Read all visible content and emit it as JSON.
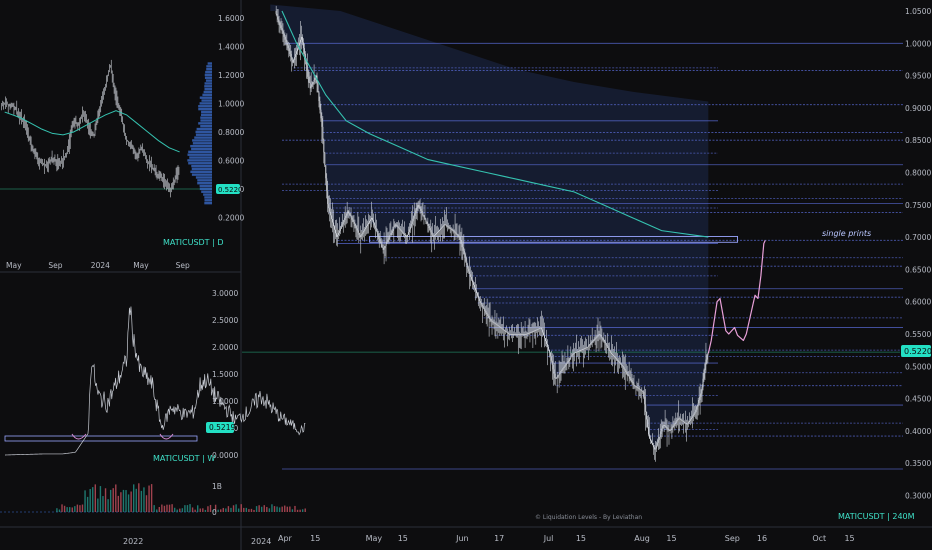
{
  "colors": {
    "background": "#0d0d0f",
    "candle": "#cfd3da",
    "moving_average": "#35c2b0",
    "zone_fill": "#1d2a4d",
    "level_line": "#5a6bd8",
    "projection": "#e8a0d8",
    "price_tag": "#23e0c4",
    "divider": "#2a2e39"
  },
  "chart_data": [
    {
      "id": "main",
      "type": "candlestick",
      "symbol_label": "MATICUSDT",
      "timeframe": "240M",
      "watermark": "© Liquidation Levels - By Leviathan",
      "annotation": "single prints",
      "current_price_label": "0.5220",
      "y_ticks": [
        "1.0500",
        "1.0000",
        "0.9500",
        "0.9000",
        "0.8500",
        "0.8000",
        "0.7500",
        "0.7000",
        "0.6500",
        "0.6000",
        "0.5500",
        "0.5000",
        "0.4500",
        "0.4000",
        "0.3500",
        "0.3000"
      ],
      "ylim": [
        0.28,
        1.06
      ],
      "x_ticks": [
        "Apr",
        "15",
        "May",
        "15",
        "Jun",
        "17",
        "Jul",
        "15",
        "Aug",
        "15",
        "Sep",
        "16",
        "Oct",
        "15"
      ],
      "x_tick_values": [
        0,
        11,
        30,
        41,
        61,
        74,
        91,
        102,
        122,
        133,
        153,
        164,
        183,
        194
      ],
      "price_path": [
        [
          -2,
          1.05
        ],
        [
          4,
          0.97
        ],
        [
          7,
          1.01
        ],
        [
          10,
          0.93
        ],
        [
          12,
          0.95
        ],
        [
          14,
          0.87
        ],
        [
          16,
          0.75
        ],
        [
          19,
          0.7
        ],
        [
          23,
          0.74
        ],
        [
          27,
          0.7
        ],
        [
          31,
          0.73
        ],
        [
          35,
          0.68
        ],
        [
          39,
          0.72
        ],
        [
          43,
          0.7
        ],
        [
          47,
          0.75
        ],
        [
          52,
          0.7
        ],
        [
          56,
          0.72
        ],
        [
          59,
          0.71
        ],
        [
          61,
          0.7
        ],
        [
          64,
          0.65
        ],
        [
          68,
          0.6
        ],
        [
          72,
          0.57
        ],
        [
          78,
          0.55
        ],
        [
          84,
          0.55
        ],
        [
          89,
          0.56
        ],
        [
          92,
          0.52
        ],
        [
          94,
          0.48
        ],
        [
          97,
          0.5
        ],
        [
          100,
          0.52
        ],
        [
          105,
          0.53
        ],
        [
          109,
          0.55
        ],
        [
          113,
          0.52
        ],
        [
          117,
          0.5
        ],
        [
          121,
          0.47
        ],
        [
          124,
          0.46
        ],
        [
          126,
          0.39
        ],
        [
          128,
          0.37
        ],
        [
          131,
          0.41
        ],
        [
          133,
          0.4
        ],
        [
          136,
          0.42
        ],
        [
          139,
          0.41
        ],
        [
          142,
          0.43
        ],
        [
          144,
          0.46
        ],
        [
          145,
          0.5
        ],
        [
          146,
          0.52
        ]
      ],
      "moving_average_path": [
        [
          0,
          1.05
        ],
        [
          5,
          1.0
        ],
        [
          10,
          0.96
        ],
        [
          15,
          0.92
        ],
        [
          22,
          0.88
        ],
        [
          30,
          0.86
        ],
        [
          40,
          0.84
        ],
        [
          50,
          0.82
        ],
        [
          60,
          0.81
        ],
        [
          70,
          0.8
        ],
        [
          80,
          0.79
        ],
        [
          90,
          0.78
        ],
        [
          100,
          0.77
        ],
        [
          110,
          0.75
        ],
        [
          120,
          0.73
        ],
        [
          130,
          0.71
        ],
        [
          146,
          0.7
        ]
      ],
      "projection_path": [
        [
          146,
          0.52
        ],
        [
          147,
          0.54
        ],
        [
          148,
          0.57
        ],
        [
          149,
          0.6
        ],
        [
          150,
          0.605
        ],
        [
          151,
          0.58
        ],
        [
          152,
          0.555
        ],
        [
          153,
          0.55
        ],
        [
          154,
          0.555
        ],
        [
          155,
          0.56
        ],
        [
          156,
          0.548
        ],
        [
          158,
          0.54
        ],
        [
          159,
          0.55
        ],
        [
          160,
          0.57
        ],
        [
          161,
          0.59
        ],
        [
          162,
          0.61
        ],
        [
          163,
          0.605
        ],
        [
          164,
          0.64
        ],
        [
          165,
          0.69
        ],
        [
          165.5,
          0.695
        ]
      ],
      "levels": [
        1.0,
        0.962,
        0.958,
        0.905,
        0.88,
        0.862,
        0.85,
        0.83,
        0.812,
        0.782,
        0.772,
        0.76,
        0.752,
        0.745,
        0.738,
        0.695,
        0.69,
        0.668,
        0.655,
        0.64,
        0.62,
        0.607,
        0.598,
        0.575,
        0.56,
        0.548,
        0.525,
        0.515,
        0.505,
        0.49,
        0.47,
        0.455,
        0.44,
        0.412,
        0.402,
        0.392,
        0.341
      ],
      "single_prints_box": {
        "x": [
          30,
          156
        ],
        "y": [
          0.692,
          0.701
        ]
      }
    },
    {
      "id": "daily",
      "type": "candlestick",
      "symbol_label": "MATICUSDT",
      "timeframe": "D",
      "current_price_label": "0.5220",
      "y_ticks": [
        "1.6000",
        "1.4000",
        "1.2000",
        "1.0000",
        "0.8000",
        "0.6000",
        "0.4000",
        "0.2000"
      ],
      "ylim": [
        0.15,
        1.72
      ],
      "x_ticks": [
        "May",
        "Sep",
        "2024",
        "May",
        "Sep"
      ],
      "x_tick_values": [
        0,
        4,
        8,
        12,
        16
      ],
      "price_path": [
        [
          -0.5,
          1.0
        ],
        [
          0.5,
          0.98
        ],
        [
          1,
          0.9
        ],
        [
          1.5,
          0.85
        ],
        [
          2,
          0.72
        ],
        [
          2.5,
          0.64
        ],
        [
          3,
          0.58
        ],
        [
          3.5,
          0.56
        ],
        [
          4,
          0.62
        ],
        [
          4.5,
          0.58
        ],
        [
          5,
          0.6
        ],
        [
          5.5,
          0.66
        ],
        [
          6,
          0.88
        ],
        [
          6.5,
          0.85
        ],
        [
          7,
          0.95
        ],
        [
          7.5,
          0.82
        ],
        [
          8,
          0.78
        ],
        [
          8.5,
          0.96
        ],
        [
          9,
          1.1
        ],
        [
          9.5,
          1.28
        ],
        [
          10,
          1.06
        ],
        [
          10.5,
          0.95
        ],
        [
          11,
          0.75
        ],
        [
          11.5,
          0.7
        ],
        [
          12,
          0.62
        ],
        [
          12.5,
          0.7
        ],
        [
          13,
          0.6
        ],
        [
          13.5,
          0.55
        ],
        [
          14,
          0.5
        ],
        [
          14.5,
          0.47
        ],
        [
          15,
          0.42
        ],
        [
          15.2,
          0.38
        ],
        [
          15.6,
          0.46
        ],
        [
          16,
          0.52
        ]
      ],
      "moving_average_path": [
        [
          -0.5,
          0.94
        ],
        [
          1,
          0.9
        ],
        [
          2,
          0.86
        ],
        [
          3,
          0.82
        ],
        [
          4,
          0.79
        ],
        [
          5,
          0.78
        ],
        [
          6,
          0.8
        ],
        [
          7,
          0.84
        ],
        [
          8,
          0.88
        ],
        [
          9,
          0.92
        ],
        [
          10,
          0.95
        ],
        [
          11,
          0.92
        ],
        [
          12,
          0.86
        ],
        [
          13,
          0.8
        ],
        [
          14,
          0.74
        ],
        [
          15,
          0.69
        ],
        [
          16,
          0.66
        ]
      ]
    },
    {
      "id": "weekly",
      "type": "line",
      "symbol_label": "MATICUSDT",
      "timeframe": "W",
      "current_price_label": "0.5219",
      "y_ticks": [
        "3.0000",
        "2.5000",
        "2.0000",
        "1.5000",
        "1.0000",
        "0.5000",
        "0.0000"
      ],
      "ylim": [
        -0.05,
        3.15
      ],
      "x_ticks": [
        "2022",
        "2024"
      ],
      "x_tick_values": [
        2022,
        2024
      ],
      "price_path": [
        [
          2020.0,
          0.0
        ],
        [
          2020.6,
          0.02
        ],
        [
          2020.9,
          0.02
        ],
        [
          2021.1,
          0.05
        ],
        [
          2021.3,
          0.4
        ],
        [
          2021.35,
          1.8
        ],
        [
          2021.45,
          1.1
        ],
        [
          2021.6,
          0.95
        ],
        [
          2021.9,
          1.75
        ],
        [
          2021.95,
          2.8
        ],
        [
          2022.0,
          2.2
        ],
        [
          2022.1,
          1.6
        ],
        [
          2022.3,
          1.3
        ],
        [
          2022.45,
          0.5
        ],
        [
          2022.6,
          0.9
        ],
        [
          2022.8,
          0.75
        ],
        [
          2022.95,
          0.8
        ],
        [
          2023.05,
          1.3
        ],
        [
          2023.15,
          1.4
        ],
        [
          2023.3,
          1.05
        ],
        [
          2023.5,
          0.8
        ],
        [
          2023.6,
          0.65
        ],
        [
          2023.8,
          0.8
        ],
        [
          2023.9,
          0.95
        ],
        [
          2024.0,
          1.1
        ],
        [
          2024.15,
          0.9
        ],
        [
          2024.3,
          0.7
        ],
        [
          2024.5,
          0.55
        ],
        [
          2024.6,
          0.45
        ],
        [
          2024.7,
          0.52
        ]
      ],
      "volume_ticks": [
        "1B",
        "0"
      ]
    }
  ]
}
